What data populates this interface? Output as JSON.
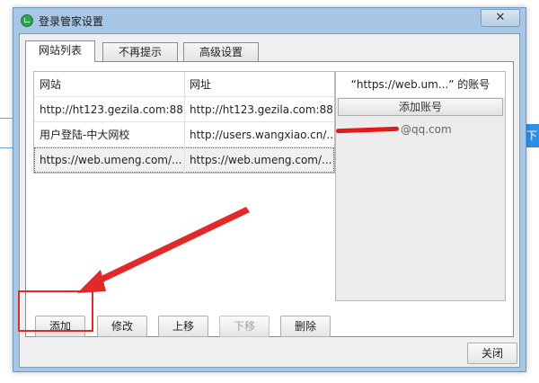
{
  "window": {
    "title": "登录管家设置",
    "close_glyph": "✕"
  },
  "background": {
    "right_button_label": "下"
  },
  "tabs": [
    {
      "label": "网站列表",
      "active": true
    },
    {
      "label": "不再提示",
      "active": false
    },
    {
      "label": "高级设置",
      "active": false
    }
  ],
  "table": {
    "headers": [
      "网站",
      "网址"
    ],
    "rows": [
      [
        "http://ht123.gezila.com:88...",
        "http://ht123.gezila.com:88..."
      ],
      [
        "用户登陆-中大网校",
        "http://users.wangxiao.cn/..."
      ],
      [
        "https://web.umeng.com/...",
        "https://web.umeng.com/..."
      ]
    ],
    "selected_row": 2
  },
  "account_panel": {
    "header": "“https://web.um...” 的账号",
    "add_account_label": "添加账号",
    "email_visible": "@qq.com"
  },
  "actions": {
    "add": "添加",
    "edit": "修改",
    "move_up": "上移",
    "move_down": "下移",
    "delete": "删除",
    "close": "关闭"
  },
  "annotation": {
    "color": "#e02a2a"
  },
  "colors": {
    "dialog_frame": "#a8c7e6",
    "accent": "#2f8fe6"
  }
}
